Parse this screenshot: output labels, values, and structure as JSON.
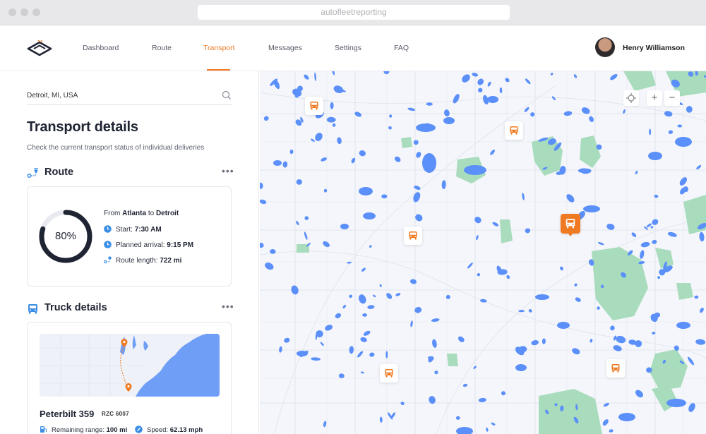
{
  "browser": {
    "url": "autofleetreporting"
  },
  "header": {
    "nav": [
      {
        "label": "Dashboard"
      },
      {
        "label": "Route"
      },
      {
        "label": "Transport",
        "active": true
      },
      {
        "label": "Messages"
      },
      {
        "label": "Settings"
      },
      {
        "label": "FAQ"
      }
    ],
    "user": {
      "name": "Henry Williamson"
    }
  },
  "sidebar": {
    "search": {
      "value": "Detroit, MI, USA"
    },
    "title": "Transport details",
    "subtitle": "Check the current transport status of individual deliveries",
    "route": {
      "heading": "Route",
      "progress_label": "80%",
      "progress": 0.8,
      "from_label": "From",
      "from": "Atlanta",
      "to_label": "to",
      "to": "Detroit",
      "start_label": "Start:",
      "start": "7:30 AM",
      "arrival_label": "Planned arrival:",
      "arrival": "9:15 PM",
      "length_label": "Route length:",
      "length": "722 mi"
    },
    "truck": {
      "heading": "Truck details",
      "name": "Peterbilt 359",
      "plate": "RZC 6007",
      "range_label": "Remaining range:",
      "range": "100 mi",
      "speed_label": "Speed:",
      "speed": "62.13 mph"
    }
  },
  "map": {
    "controls": {
      "zoom_in": "+",
      "zoom_out": "−"
    },
    "colors": {
      "accent": "#f07a22",
      "water": "#5b8ff9",
      "park": "#a8dcbc",
      "ring": "#1f2433"
    }
  }
}
